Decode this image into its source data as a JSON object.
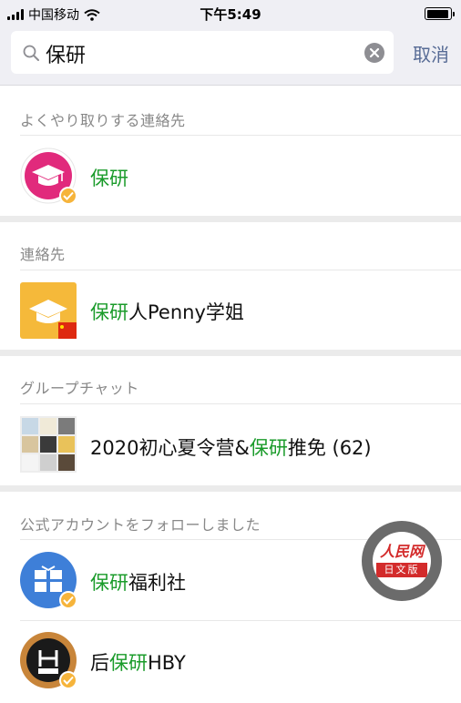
{
  "status_bar": {
    "carrier": "中国移动",
    "time": "下午5:49"
  },
  "search": {
    "query": "保研",
    "cancel_label": "取消"
  },
  "sections": [
    {
      "title": "よくやり取りする連絡先",
      "items": [
        {
          "pre": "",
          "highlight": "保研",
          "post": "",
          "avatar": "graduation-cap-icon"
        }
      ]
    },
    {
      "title": "連絡先",
      "items": [
        {
          "pre": "",
          "highlight": "保研",
          "post": "人Penny学姐",
          "avatar": "graduation-cap-icon"
        }
      ]
    },
    {
      "title": "グループチャット",
      "items": [
        {
          "pre": "2020初心夏令营&",
          "highlight": "保研",
          "post": "推免 (62)",
          "avatar": "group-avatar"
        }
      ]
    },
    {
      "title": "公式アカウントをフォローしました",
      "items": [
        {
          "pre": "",
          "highlight": "保研",
          "post": "福利社",
          "avatar": "gift-icon"
        },
        {
          "pre": "后",
          "highlight": "保研",
          "post": "HBY",
          "avatar": "hby-logo"
        }
      ]
    }
  ],
  "floating_button": {
    "top_text": "人民网",
    "bottom_text": "日文版"
  },
  "colors": {
    "highlight": "#1a9b2a",
    "cancel": "#576b95",
    "badge": "#f6b43b"
  }
}
